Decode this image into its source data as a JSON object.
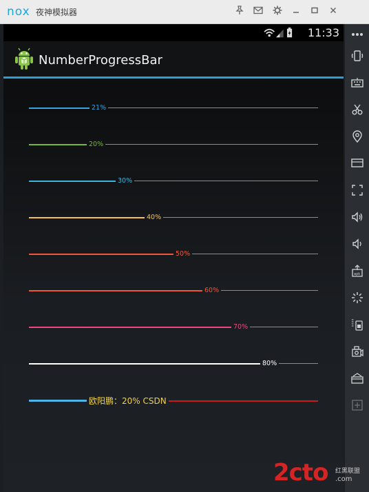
{
  "emulator": {
    "brand": "nox",
    "title": "夜神模拟器",
    "controls": [
      "pin-icon",
      "mail-icon",
      "gear-icon",
      "minimize-icon",
      "maximize-icon",
      "close-icon"
    ]
  },
  "statusbar": {
    "time": "11:33"
  },
  "actionbar": {
    "title": "NumberProgressBar"
  },
  "progress_bars": [
    {
      "text": "21%",
      "progress": 0.21,
      "color": "#3aa3e0"
    },
    {
      "text": "20%",
      "progress": 0.2,
      "color": "#78b83a"
    },
    {
      "text": "30%",
      "progress": 0.3,
      "color": "#3bb7de"
    },
    {
      "text": "40%",
      "progress": 0.4,
      "color": "#f6c15a"
    },
    {
      "text": "50%",
      "progress": 0.5,
      "color": "#f0573a"
    },
    {
      "text": "60%",
      "progress": 0.6,
      "color": "#f0573a"
    },
    {
      "text": "70%",
      "progress": 0.7,
      "color": "#f0487a"
    },
    {
      "text": "80%",
      "progress": 0.8,
      "color": "#ffffff"
    },
    {
      "text": "欧阳鹏：20%  CSDN",
      "progress": 0.2,
      "color": "#4fb3e8",
      "text_color": "#f0d24a",
      "unreached_color": "#cc1b1b"
    }
  ],
  "toolbar_icons": [
    "rotate-icon",
    "keyboard-icon",
    "scissors-icon",
    "location-icon",
    "screen-icon",
    "fullscreen-icon",
    "volume-up-icon",
    "volume-down-icon",
    "apk-icon",
    "loading-icon",
    "shake-icon",
    "camera-icon",
    "menu-icon",
    "add-icon"
  ],
  "watermark": {
    "main": "2cto",
    "sub": "红黑联盟",
    "domain": ".com"
  }
}
